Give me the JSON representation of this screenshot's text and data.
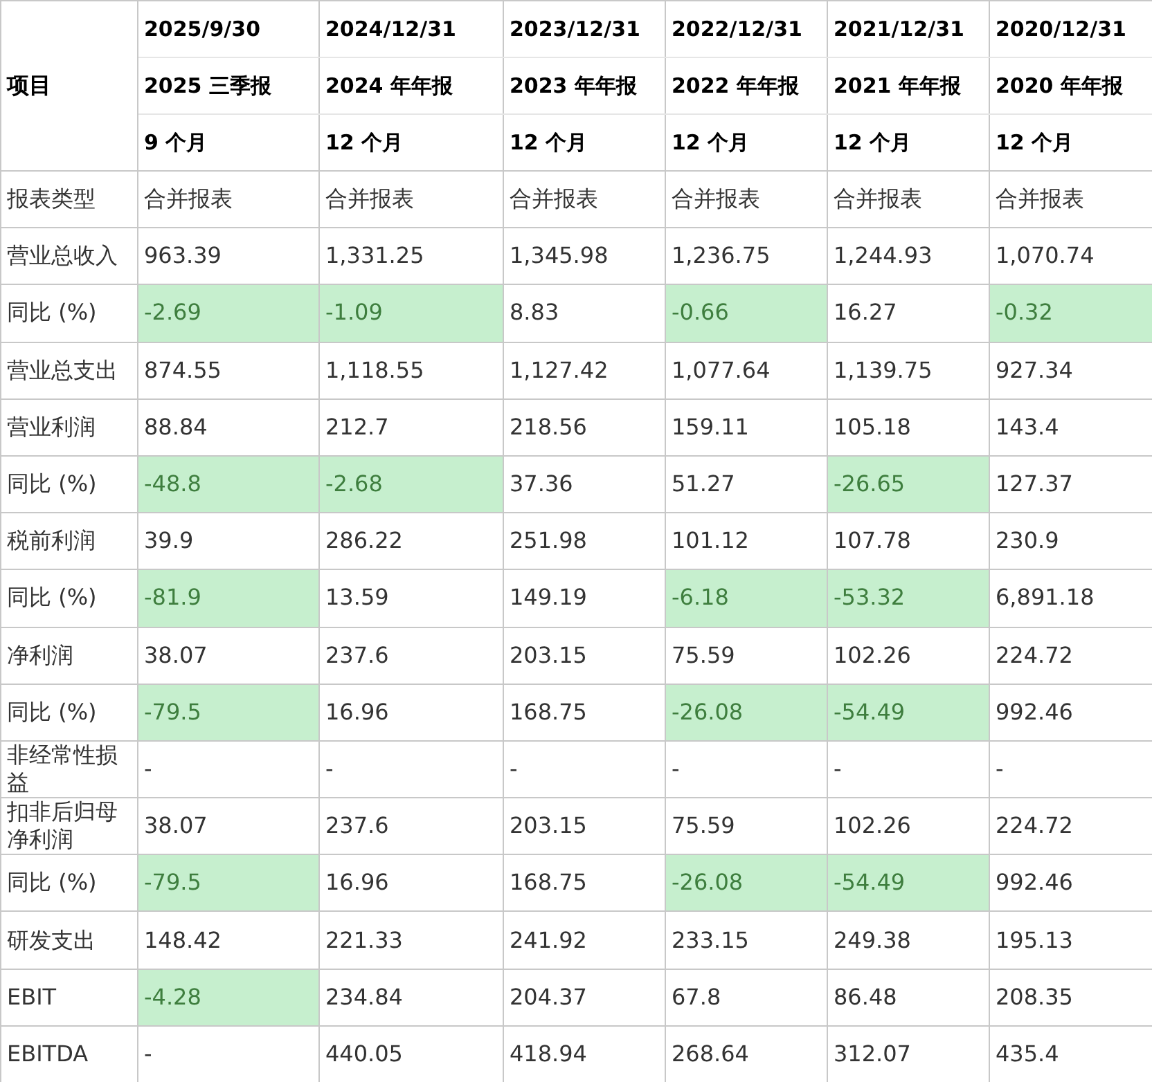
{
  "table": {
    "corner": "项目",
    "columns": [
      {
        "date": "2025/9/30",
        "report": "2025 三季报",
        "period": "9 个月"
      },
      {
        "date": "2024/12/31",
        "report": "2024 年年报",
        "period": "12 个月"
      },
      {
        "date": "2023/12/31",
        "report": "2023 年年报",
        "period": "12 个月"
      },
      {
        "date": "2022/12/31",
        "report": "2022 年年报",
        "period": "12 个月"
      },
      {
        "date": "2021/12/31",
        "report": "2021 年年报",
        "period": "12 个月"
      },
      {
        "date": "2020/12/31",
        "report": "2020 年年报",
        "period": "12 个月"
      }
    ],
    "rows": [
      {
        "label": "报表类型",
        "cells": [
          {
            "text": "合并报表",
            "highlighted": false
          },
          {
            "text": "合并报表",
            "highlighted": false
          },
          {
            "text": "合并报表",
            "highlighted": false
          },
          {
            "text": "合并报表",
            "highlighted": false
          },
          {
            "text": "合并报表",
            "highlighted": false
          },
          {
            "text": "合并报表",
            "highlighted": false
          }
        ]
      },
      {
        "label": "营业总收入",
        "cells": [
          {
            "text": "963.39",
            "highlighted": false
          },
          {
            "text": "1,331.25",
            "highlighted": false
          },
          {
            "text": "1,345.98",
            "highlighted": false
          },
          {
            "text": "1,236.75",
            "highlighted": false
          },
          {
            "text": "1,244.93",
            "highlighted": false
          },
          {
            "text": "1,070.74",
            "highlighted": false
          }
        ]
      },
      {
        "label": "同比 (%)",
        "cells": [
          {
            "text": "-2.69",
            "highlighted": true
          },
          {
            "text": "-1.09",
            "highlighted": true
          },
          {
            "text": "8.83",
            "highlighted": false
          },
          {
            "text": "-0.66",
            "highlighted": true
          },
          {
            "text": "16.27",
            "highlighted": false
          },
          {
            "text": "-0.32",
            "highlighted": true
          }
        ]
      },
      {
        "label": "营业总支出",
        "cells": [
          {
            "text": "874.55",
            "highlighted": false
          },
          {
            "text": "1,118.55",
            "highlighted": false
          },
          {
            "text": "1,127.42",
            "highlighted": false
          },
          {
            "text": "1,077.64",
            "highlighted": false
          },
          {
            "text": "1,139.75",
            "highlighted": false
          },
          {
            "text": "927.34",
            "highlighted": false
          }
        ]
      },
      {
        "label": "营业利润",
        "cells": [
          {
            "text": "88.84",
            "highlighted": false
          },
          {
            "text": "212.7",
            "highlighted": false
          },
          {
            "text": "218.56",
            "highlighted": false
          },
          {
            "text": "159.11",
            "highlighted": false
          },
          {
            "text": "105.18",
            "highlighted": false
          },
          {
            "text": "143.4",
            "highlighted": false
          }
        ]
      },
      {
        "label": "同比 (%)",
        "cells": [
          {
            "text": "-48.8",
            "highlighted": true
          },
          {
            "text": "-2.68",
            "highlighted": true
          },
          {
            "text": "37.36",
            "highlighted": false
          },
          {
            "text": "51.27",
            "highlighted": false
          },
          {
            "text": "-26.65",
            "highlighted": true
          },
          {
            "text": "127.37",
            "highlighted": false
          }
        ]
      },
      {
        "label": "税前利润",
        "cells": [
          {
            "text": "39.9",
            "highlighted": false
          },
          {
            "text": "286.22",
            "highlighted": false
          },
          {
            "text": "251.98",
            "highlighted": false
          },
          {
            "text": "101.12",
            "highlighted": false
          },
          {
            "text": "107.78",
            "highlighted": false
          },
          {
            "text": "230.9",
            "highlighted": false
          }
        ]
      },
      {
        "label": "同比 (%)",
        "cells": [
          {
            "text": "-81.9",
            "highlighted": true
          },
          {
            "text": "13.59",
            "highlighted": false
          },
          {
            "text": "149.19",
            "highlighted": false
          },
          {
            "text": "-6.18",
            "highlighted": true
          },
          {
            "text": "-53.32",
            "highlighted": true
          },
          {
            "text": "6,891.18",
            "highlighted": false
          }
        ]
      },
      {
        "label": "净利润",
        "cells": [
          {
            "text": "38.07",
            "highlighted": false
          },
          {
            "text": "237.6",
            "highlighted": false
          },
          {
            "text": "203.15",
            "highlighted": false
          },
          {
            "text": "75.59",
            "highlighted": false
          },
          {
            "text": "102.26",
            "highlighted": false
          },
          {
            "text": "224.72",
            "highlighted": false
          }
        ]
      },
      {
        "label": "同比 (%)",
        "cells": [
          {
            "text": "-79.5",
            "highlighted": true
          },
          {
            "text": "16.96",
            "highlighted": false
          },
          {
            "text": "168.75",
            "highlighted": false
          },
          {
            "text": "-26.08",
            "highlighted": true
          },
          {
            "text": "-54.49",
            "highlighted": true
          },
          {
            "text": "992.46",
            "highlighted": false
          }
        ]
      },
      {
        "label": "非经常性损益",
        "cells": [
          {
            "text": "-",
            "highlighted": false
          },
          {
            "text": "-",
            "highlighted": false
          },
          {
            "text": "-",
            "highlighted": false
          },
          {
            "text": "-",
            "highlighted": false
          },
          {
            "text": "-",
            "highlighted": false
          },
          {
            "text": "-",
            "highlighted": false
          }
        ]
      },
      {
        "label": "扣非后归母净利润",
        "cells": [
          {
            "text": "38.07",
            "highlighted": false
          },
          {
            "text": "237.6",
            "highlighted": false
          },
          {
            "text": "203.15",
            "highlighted": false
          },
          {
            "text": "75.59",
            "highlighted": false
          },
          {
            "text": "102.26",
            "highlighted": false
          },
          {
            "text": "224.72",
            "highlighted": false
          }
        ]
      },
      {
        "label": "同比 (%)",
        "cells": [
          {
            "text": "-79.5",
            "highlighted": true
          },
          {
            "text": "16.96",
            "highlighted": false
          },
          {
            "text": "168.75",
            "highlighted": false
          },
          {
            "text": "-26.08",
            "highlighted": true
          },
          {
            "text": "-54.49",
            "highlighted": true
          },
          {
            "text": "992.46",
            "highlighted": false
          }
        ]
      },
      {
        "label": "研发支出",
        "cells": [
          {
            "text": "148.42",
            "highlighted": false
          },
          {
            "text": "221.33",
            "highlighted": false
          },
          {
            "text": "241.92",
            "highlighted": false
          },
          {
            "text": "233.15",
            "highlighted": false
          },
          {
            "text": "249.38",
            "highlighted": false
          },
          {
            "text": "195.13",
            "highlighted": false
          }
        ]
      },
      {
        "label": "EBIT",
        "cells": [
          {
            "text": "-4.28",
            "highlighted": true
          },
          {
            "text": "234.84",
            "highlighted": false
          },
          {
            "text": "204.37",
            "highlighted": false
          },
          {
            "text": "67.8",
            "highlighted": false
          },
          {
            "text": "86.48",
            "highlighted": false
          },
          {
            "text": "208.35",
            "highlighted": false
          }
        ]
      },
      {
        "label": "EBITDA",
        "cells": [
          {
            "text": "-",
            "highlighted": false
          },
          {
            "text": "440.05",
            "highlighted": false
          },
          {
            "text": "418.94",
            "highlighted": false
          },
          {
            "text": "268.64",
            "highlighted": false
          },
          {
            "text": "312.07",
            "highlighted": false
          },
          {
            "text": "435.4",
            "highlighted": false
          }
        ]
      }
    ]
  }
}
